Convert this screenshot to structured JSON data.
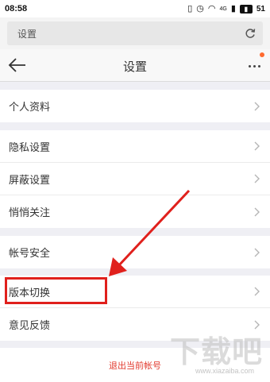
{
  "status_bar": {
    "time": "08:58",
    "network": "4G",
    "battery": "51"
  },
  "address_bar": {
    "text": "设置"
  },
  "header": {
    "title": "设置"
  },
  "settings_items": [
    {
      "label": "个人资料"
    },
    {
      "label": "隐私设置"
    },
    {
      "label": "屏蔽设置"
    },
    {
      "label": "悄悄关注"
    },
    {
      "label": "帐号安全"
    },
    {
      "label": "版本切换"
    },
    {
      "label": "意见反馈"
    }
  ],
  "logout_label": "退出当前帐号",
  "annotation": {
    "color": "#e0201c",
    "highlighted_item": "版本切换"
  },
  "watermark": {
    "main": "下载吧",
    "sub": "www.xiazaiba.com"
  },
  "colors": {
    "background": "#efeff4",
    "logout_text": "#e23a2e",
    "notify_dot": "#ff6a2f"
  }
}
